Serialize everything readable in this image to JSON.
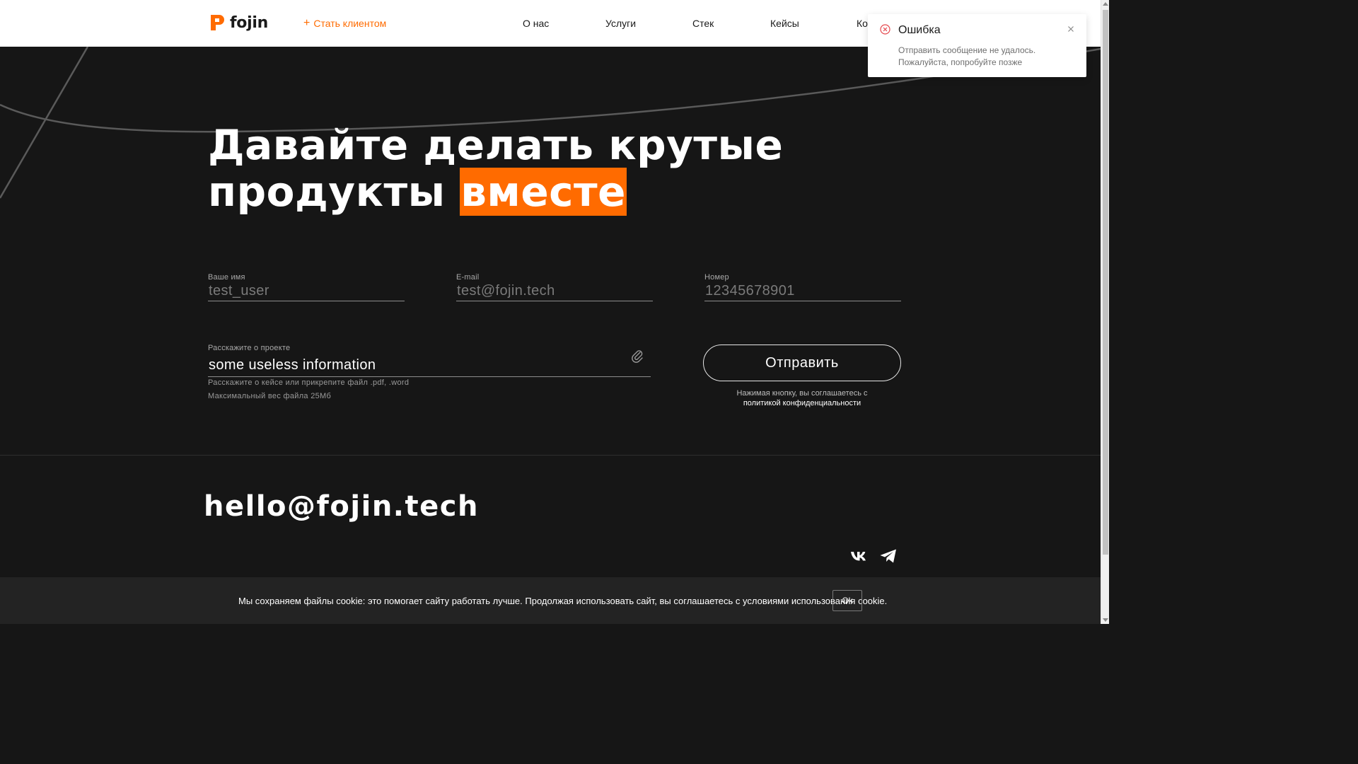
{
  "header": {
    "logo_text": "fojin",
    "become_client": "Стать клиентом",
    "nav": [
      {
        "label": "О нас"
      },
      {
        "label": "Услуги"
      },
      {
        "label": "Стек"
      },
      {
        "label": "Кейсы"
      },
      {
        "label": "Ко"
      }
    ]
  },
  "hero": {
    "line1": "Давайте делать крутые",
    "line2_start": "продукты ",
    "line2_highlight": "вместе"
  },
  "form": {
    "name_label": "Ваше имя",
    "name_value": "test_user",
    "email_label": "E-mail",
    "email_value": "test@fojin.tech",
    "phone_label": "Номер",
    "phone_value": "12345678901",
    "message_label": "Расскажите о проекте",
    "message_value": "some useless information",
    "hint1": "Расскажите о кейсе или прикрепите файл .pdf, .word",
    "hint2": "Максимальный вес файла 25Мб",
    "submit_label": "Отправить",
    "agree_text": "Нажимая кнопку, вы соглашаетесь с",
    "policy_link": "политикой конфиденциальности"
  },
  "footer": {
    "email": "hello@fojin.tech",
    "socials": [
      "vk-icon",
      "telegram-icon"
    ]
  },
  "cookie": {
    "text": "Мы сохраняем файлы cookie: это помогает сайту работать лучше. Продолжая использовать сайт, вы соглашаетесь с условиями использования cookie.",
    "button": "Ok"
  },
  "toast": {
    "title": "Ошибка",
    "message_line1": "Отправить сообщение не удалось.",
    "message_line2": "Пожалуйста, попробуйте позже"
  },
  "colors": {
    "accent": "#ff6b00",
    "background": "#161616",
    "error": "#e5484d"
  }
}
